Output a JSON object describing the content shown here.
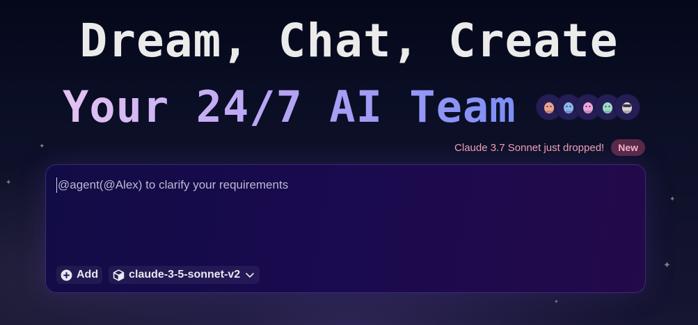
{
  "hero": {
    "title_line1": "Dream, Chat, Create",
    "title_line2": "Your 24/7 AI Team"
  },
  "team_avatars": [
    {
      "name": "agent-1",
      "color": "#e7a58f"
    },
    {
      "name": "agent-2",
      "color": "#8fb6ea"
    },
    {
      "name": "agent-3",
      "color": "#e9a7d6"
    },
    {
      "name": "agent-4",
      "color": "#9fd8c7"
    },
    {
      "name": "agent-5",
      "color": "#d9d4d6"
    }
  ],
  "promo": {
    "text": "Claude 3.7 Sonnet just dropped!",
    "badge": "New"
  },
  "chat": {
    "placeholder": "@agent(@Alex) to clarify your requirements",
    "add_label": "Add",
    "model_label": "claude-3-5-sonnet-v2"
  },
  "colors": {
    "background": "#0b0f26",
    "chat_box": "#1a0a4e",
    "promo_text": "#f3a3b4",
    "badge_bg": "#5a2a48"
  }
}
